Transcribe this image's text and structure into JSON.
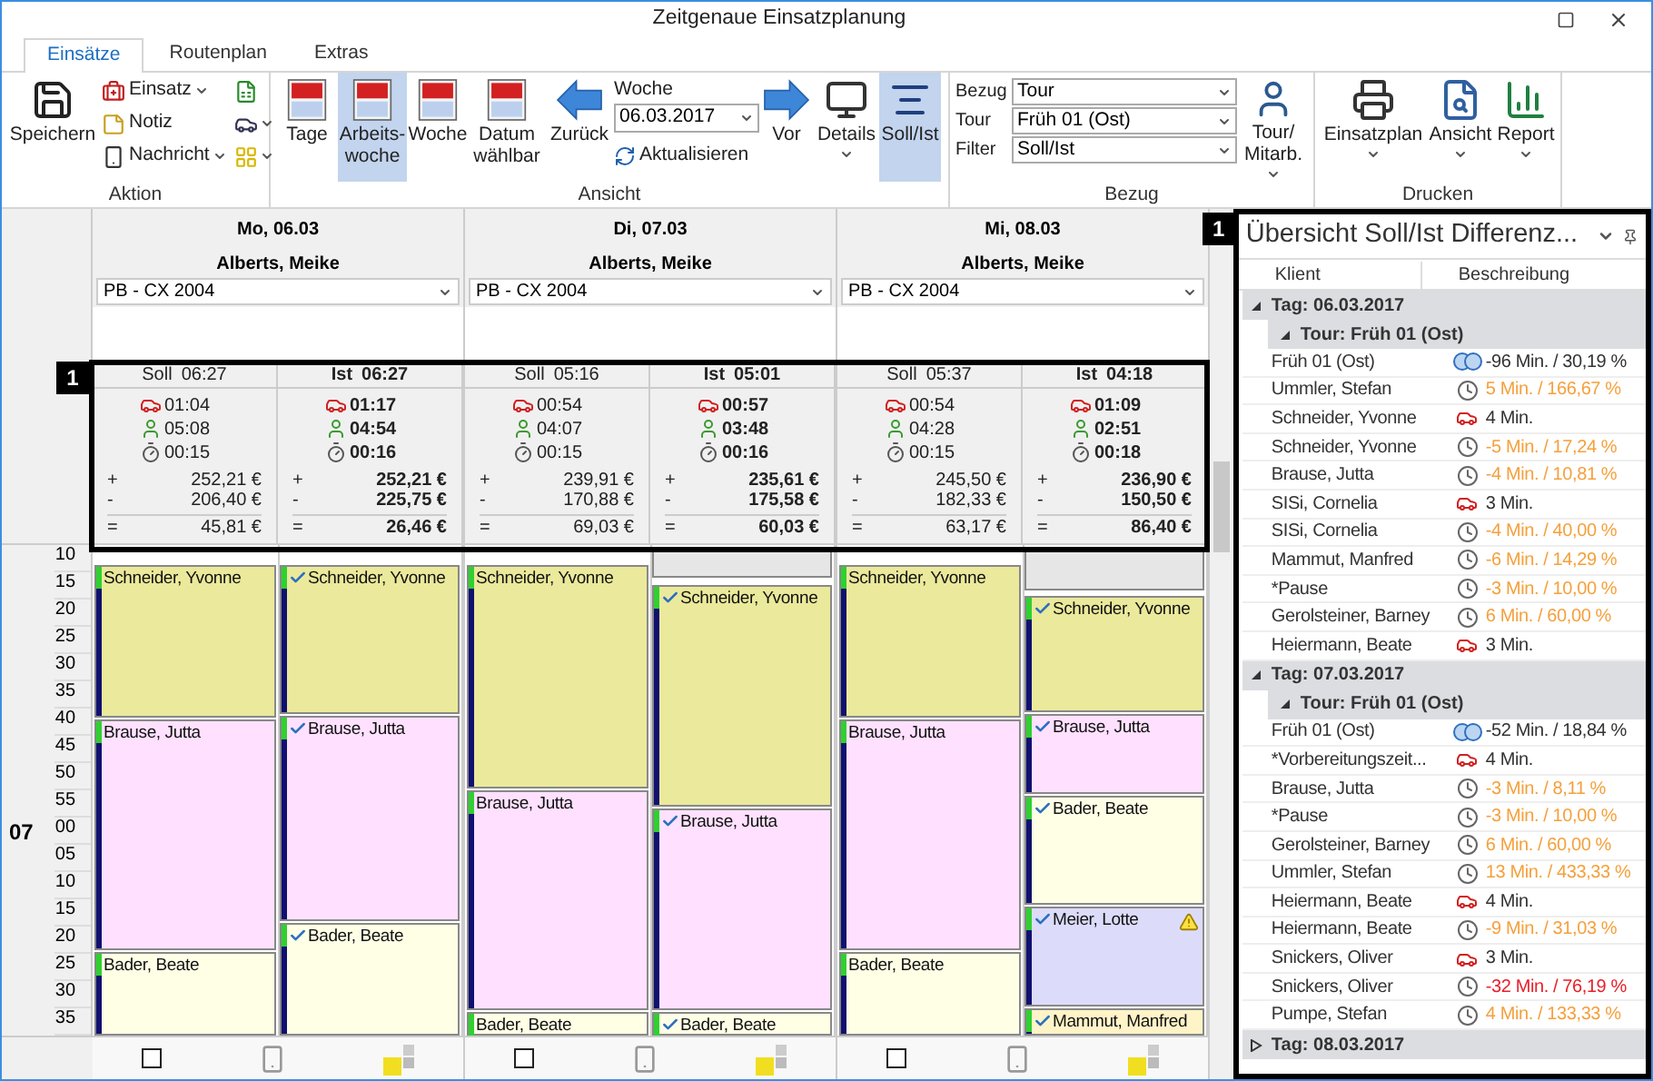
{
  "window": {
    "title": "Zeitgenaue Einsatzplanung"
  },
  "tabs": [
    {
      "label": "Einsätze",
      "selected": true
    },
    {
      "label": "Routenplan",
      "selected": false
    },
    {
      "label": "Extras",
      "selected": false
    }
  ],
  "ribbon": {
    "aktion": {
      "label": "Aktion",
      "save": {
        "label": "Speichern"
      },
      "small": [
        {
          "label": "Einsatz",
          "dropdown": true
        },
        {
          "label": "Notiz",
          "dropdown": false
        },
        {
          "label": "Nachricht",
          "dropdown": true
        }
      ],
      "icon_buttons": [
        {
          "dropdown": false
        },
        {
          "dropdown": true
        },
        {
          "dropdown": true
        }
      ]
    },
    "ansicht": {
      "label": "Ansicht",
      "views": [
        {
          "label": "Tage",
          "selected": false
        },
        {
          "label": "Arbeits-woche",
          "selected": true
        },
        {
          "label": "Woche",
          "selected": false
        },
        {
          "label": "Datum wählbar",
          "selected": false
        }
      ],
      "back": {
        "label": "Zurück"
      },
      "week": {
        "label": "Woche",
        "value": "06.03.2017"
      },
      "refresh": {
        "label": "Aktualisieren"
      },
      "forward": {
        "label": "Vor"
      },
      "details": {
        "label": "Details",
        "dropdown": true
      },
      "soll_ist": {
        "label": "Soll/Ist",
        "selected": true
      }
    },
    "bezug": {
      "label": "Bezug",
      "fields": [
        {
          "label": "Bezug",
          "value": "Tour"
        },
        {
          "label": "Tour",
          "value": "Früh 01 (Ost)"
        },
        {
          "label": "Filter",
          "value": "Soll/Ist"
        }
      ],
      "person": {
        "label": "Tour/ Mitarb.",
        "dropdown": true
      }
    },
    "drucken": {
      "label": "Drucken",
      "buttons": [
        {
          "label": "Einsatzplan",
          "dropdown": true
        },
        {
          "label": "Ansicht",
          "dropdown": true
        },
        {
          "label": "Report",
          "dropdown": true
        }
      ]
    }
  },
  "callouts": [
    "1",
    "1"
  ],
  "time_axis": [
    {
      "minute": "10"
    },
    {
      "minute": "15"
    },
    {
      "minute": "20"
    },
    {
      "minute": "25"
    },
    {
      "minute": "30"
    },
    {
      "minute": "35"
    },
    {
      "minute": "40"
    },
    {
      "minute": "45"
    },
    {
      "minute": "50"
    },
    {
      "minute": "55"
    },
    {
      "hour": "07",
      "minute": "00"
    },
    {
      "minute": "05"
    },
    {
      "minute": "10"
    },
    {
      "minute": "15"
    },
    {
      "minute": "20"
    },
    {
      "minute": "25"
    },
    {
      "minute": "30"
    },
    {
      "minute": "35"
    }
  ],
  "days": [
    {
      "date": "Mo, 06.03",
      "employee": "Alberts, Meike",
      "vehicle": "PB - CX 2004",
      "checked": false,
      "plan": [
        {
          "kind": "soll",
          "label": "Soll",
          "total": "06:27",
          "drive": "01:04",
          "care": "05:08",
          "pause": "00:15",
          "money": [
            {
              "sign": "+",
              "amount": "252,21 €"
            },
            {
              "sign": "-",
              "amount": "206,40 €"
            },
            {
              "sign": "=",
              "amount": "45,81 €"
            }
          ],
          "appointments": [
            {
              "name": "Schneider, Yvonne",
              "color": "#ebe99b",
              "checked": false
            },
            {
              "name": "Brause, Jutta",
              "color": "#ffe1ff",
              "checked": false
            },
            {
              "name": "Bader, Beate",
              "color": "#ffffe6",
              "checked": false
            }
          ]
        },
        {
          "kind": "ist",
          "label": "Ist",
          "total": "06:27",
          "drive": "01:17",
          "care": "04:54",
          "pause": "00:16",
          "money": [
            {
              "sign": "+",
              "amount": "252,21 €"
            },
            {
              "sign": "-",
              "amount": "225,75 €"
            },
            {
              "sign": "=",
              "amount": "26,46 €"
            }
          ],
          "appointments": [
            {
              "name": "Schneider, Yvonne",
              "color": "#ebe99b",
              "checked": true
            },
            {
              "name": "Brause, Jutta",
              "color": "#ffe1ff",
              "checked": true
            },
            {
              "name": "Bader, Beate",
              "color": "#ffffe6",
              "checked": true
            }
          ]
        }
      ]
    },
    {
      "date": "Di, 07.03",
      "employee": "Alberts, Meike",
      "vehicle": "PB - CX 2004",
      "checked": false,
      "plan": [
        {
          "kind": "soll",
          "label": "Soll",
          "total": "05:16",
          "drive": "00:54",
          "care": "04:07",
          "pause": "00:15",
          "money": [
            {
              "sign": "+",
              "amount": "239,91 €"
            },
            {
              "sign": "-",
              "amount": "170,88 €"
            },
            {
              "sign": "=",
              "amount": "69,03 €"
            }
          ],
          "appointments": [
            {
              "name": "Schneider, Yvonne",
              "color": "#ebe99b",
              "checked": false
            },
            {
              "name": "Brause, Jutta",
              "color": "#ffe1ff",
              "checked": false
            },
            {
              "name": "Bader, Beate",
              "color": "#ffffe6",
              "checked": false
            }
          ]
        },
        {
          "kind": "ist",
          "label": "Ist",
          "total": "05:01",
          "drive": "00:57",
          "care": "03:48",
          "pause": "00:16",
          "money": [
            {
              "sign": "+",
              "amount": "235,61 €"
            },
            {
              "sign": "-",
              "amount": "175,58 €"
            },
            {
              "sign": "=",
              "amount": "60,03 €"
            }
          ],
          "appointments": [
            {
              "color": "#e6e6e6",
              "checked": false
            },
            {
              "name": "Schneider, Yvonne",
              "color": "#ebe99b",
              "checked": true
            },
            {
              "name": "Brause, Jutta",
              "color": "#ffe1ff",
              "checked": true
            },
            {
              "name": "Bader, Beate",
              "color": "#ffffe6",
              "checked": true
            }
          ]
        }
      ]
    },
    {
      "date": "Mi, 08.03",
      "employee": "Alberts, Meike",
      "vehicle": "PB - CX 2004",
      "checked": false,
      "plan": [
        {
          "kind": "soll",
          "label": "Soll",
          "total": "05:37",
          "drive": "00:54",
          "care": "04:28",
          "pause": "00:15",
          "money": [
            {
              "sign": "+",
              "amount": "245,50 €"
            },
            {
              "sign": "-",
              "amount": "182,33 €"
            },
            {
              "sign": "=",
              "amount": "63,17 €"
            }
          ],
          "appointments": [
            {
              "name": "Schneider, Yvonne",
              "color": "#ebe99b",
              "checked": false
            },
            {
              "name": "Brause, Jutta",
              "color": "#ffe1ff",
              "checked": false
            },
            {
              "name": "Bader, Beate",
              "color": "#ffffe6",
              "checked": false
            }
          ]
        },
        {
          "kind": "ist",
          "label": "Ist",
          "total": "04:18",
          "drive": "01:09",
          "care": "02:51",
          "pause": "00:18",
          "money": [
            {
              "sign": "+",
              "amount": "236,90 €"
            },
            {
              "sign": "-",
              "amount": "150,50 €"
            },
            {
              "sign": "=",
              "amount": "86,40 €"
            }
          ],
          "appointments": [
            {
              "color": "#e6e6e6",
              "checked": false
            },
            {
              "name": "Schneider, Yvonne",
              "color": "#ebe99b",
              "checked": true
            },
            {
              "name": "Brause, Jutta",
              "color": "#ffe1ff",
              "checked": true
            },
            {
              "name": "Bader, Beate",
              "color": "#ffffe6",
              "checked": true
            },
            {
              "name": "Meier, Lotte",
              "color": "#dcdcfa",
              "checked": true,
              "warning": true
            },
            {
              "name": "Mammut, Manfred",
              "color": "#fff3c8",
              "checked": true
            }
          ]
        }
      ]
    }
  ],
  "panel": {
    "title": "Übersicht Soll/Ist Differenz...",
    "columns": [
      "Klient",
      "Beschreibung"
    ],
    "days": [
      {
        "label": "Tag: 06.03.2017",
        "expanded": true,
        "tours": [
          {
            "label": "Tour: Früh 01 (Ost)",
            "expanded": true,
            "rows": [
              {
                "client": "Früh 01 (Ost)",
                "kind": "tour",
                "text": "-96 Min. / 30,19 %",
                "color": "#333333"
              },
              {
                "client": "Ummler, Stefan",
                "kind": "clock",
                "text": "5 Min. / 166,67 %",
                "color": "#f5a03c"
              },
              {
                "client": "Schneider, Yvonne",
                "kind": "car",
                "text": "4 Min.",
                "color": "#333333"
              },
              {
                "client": "Schneider, Yvonne",
                "kind": "clock",
                "text": "-5 Min. / 17,24 %",
                "color": "#f5a03c"
              },
              {
                "client": "Brause, Jutta",
                "kind": "clock",
                "text": "-4 Min. / 10,81 %",
                "color": "#f5a03c"
              },
              {
                "client": "SISi, Cornelia",
                "kind": "car",
                "text": "3 Min.",
                "color": "#333333"
              },
              {
                "client": "SISi, Cornelia",
                "kind": "clock",
                "text": "-4 Min. / 40,00 %",
                "color": "#f5a03c"
              },
              {
                "client": "Mammut, Manfred",
                "kind": "clock",
                "text": "-6 Min. / 14,29 %",
                "color": "#f5a03c"
              },
              {
                "client": "*Pause",
                "kind": "clock",
                "text": "-3 Min. / 10,00 %",
                "color": "#f5a03c"
              },
              {
                "client": "Gerolsteiner, Barney",
                "kind": "clock",
                "text": "6 Min. / 60,00 %",
                "color": "#f5a03c"
              },
              {
                "client": "Heiermann, Beate",
                "kind": "car",
                "text": "3 Min.",
                "color": "#333333"
              }
            ]
          }
        ]
      },
      {
        "label": "Tag: 07.03.2017",
        "expanded": true,
        "tours": [
          {
            "label": "Tour: Früh 01 (Ost)",
            "expanded": true,
            "rows": [
              {
                "client": "Früh 01 (Ost)",
                "kind": "tour",
                "text": "-52 Min. / 18,84 %",
                "color": "#333333"
              },
              {
                "client": "*Vorbereitungszeit...",
                "kind": "car",
                "text": "4 Min.",
                "color": "#333333"
              },
              {
                "client": "Brause, Jutta",
                "kind": "clock",
                "text": "-3 Min. / 8,11 %",
                "color": "#f5a03c"
              },
              {
                "client": "*Pause",
                "kind": "clock",
                "text": "-3 Min. / 10,00 %",
                "color": "#f5a03c"
              },
              {
                "client": "Gerolsteiner, Barney",
                "kind": "clock",
                "text": "6 Min. / 60,00 %",
                "color": "#f5a03c"
              },
              {
                "client": "Ummler, Stefan",
                "kind": "clock",
                "text": "13 Min. / 433,33 %",
                "color": "#f5a03c"
              },
              {
                "client": "Heiermann, Beate",
                "kind": "car",
                "text": "4 Min.",
                "color": "#333333"
              },
              {
                "client": "Heiermann, Beate",
                "kind": "clock",
                "text": "-9 Min. / 31,03 %",
                "color": "#f5a03c"
              },
              {
                "client": "Snickers, Oliver",
                "kind": "car",
                "text": "3 Min.",
                "color": "#333333"
              },
              {
                "client": "Snickers, Oliver",
                "kind": "clock",
                "text": "-32 Min. / 76,19 %",
                "color": "#e8202a"
              },
              {
                "client": "Pumpe, Stefan",
                "kind": "clock",
                "text": "4 Min. / 133,33 %",
                "color": "#f5a03c"
              }
            ]
          }
        ]
      },
      {
        "label": "Tag: 08.03.2017",
        "expanded": false
      }
    ]
  }
}
